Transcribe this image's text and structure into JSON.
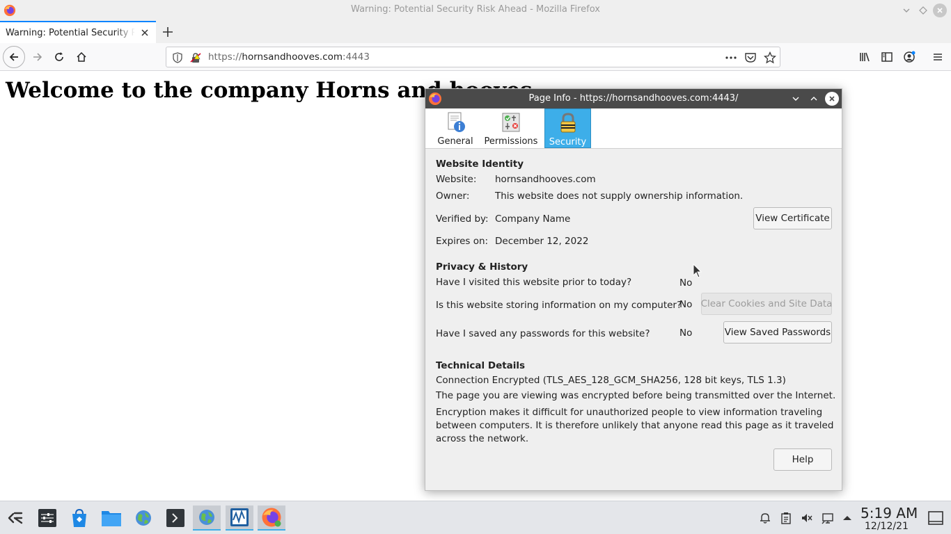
{
  "window": {
    "title": "Warning: Potential Security Risk Ahead - Mozilla Firefox"
  },
  "tab": {
    "title": "Warning: Potential Security Ri"
  },
  "urlbar": {
    "scheme": "https://",
    "host": "hornsandhooves.com",
    "port": ":4443"
  },
  "page": {
    "heading": "Welcome to the company Horns and hooves"
  },
  "dialog": {
    "title": "Page Info - https://hornsandhooves.com:4443/",
    "tabs": [
      {
        "label": "General",
        "icon": "info-icon",
        "active": false
      },
      {
        "label": "Permissions",
        "icon": "permissions-icon",
        "active": false
      },
      {
        "label": "Security",
        "icon": "padlock-icon",
        "active": true
      }
    ],
    "identity": {
      "heading": "Website Identity",
      "website_label": "Website:",
      "website_value": "hornsandhooves.com",
      "owner_label": "Owner:",
      "owner_value": "This website does not supply ownership information.",
      "verified_label": "Verified by:",
      "verified_value": "Company Name",
      "expires_label": "Expires on:",
      "expires_value": "December 12, 2022",
      "view_certificate": "View Certificate"
    },
    "privacy": {
      "heading": "Privacy & History",
      "q1": "Have I visited this website prior to today?",
      "a1": "No",
      "q2": "Is this website storing information on my computer?",
      "a2": "No",
      "clear_button": "Clear Cookies and Site Data",
      "q3": "Have I saved any passwords for this website?",
      "a3": "No",
      "passwords_button": "View Saved Passwords"
    },
    "technical": {
      "heading": "Technical Details",
      "connection": "Connection Encrypted (TLS_AES_128_GCM_SHA256, 128 bit keys, TLS 1.3)",
      "line1": "The page you are viewing was encrypted before being transmitted over the Internet.",
      "line2": "Encryption makes it difficult for unauthorized people to view information traveling between computers. It is therefore unlikely that anyone read this page as it traveled across the network."
    },
    "help_button": "Help"
  },
  "taskbar": {
    "time": "5:19 AM",
    "date": "12/12/21"
  },
  "colors": {
    "accent": "#3daee9",
    "firefox_tab_accent": "#0a84ff",
    "dialog_titlebar": "#4a4a4a"
  }
}
